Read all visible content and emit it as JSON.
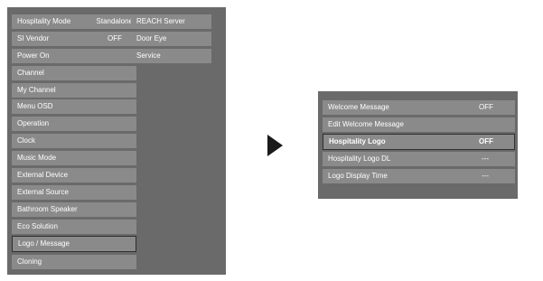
{
  "main_menu": {
    "items": [
      {
        "label": "Hospitality Mode",
        "value": "Standalone"
      },
      {
        "label": "SI Vendor",
        "value": "OFF"
      },
      {
        "label": "Power On",
        "value": ""
      },
      {
        "label": "Channel",
        "value": ""
      },
      {
        "label": "My Channel",
        "value": ""
      },
      {
        "label": "Menu OSD",
        "value": ""
      },
      {
        "label": "Operation",
        "value": ""
      },
      {
        "label": "Clock",
        "value": ""
      },
      {
        "label": "Music Mode",
        "value": ""
      },
      {
        "label": "External Device",
        "value": ""
      },
      {
        "label": "External Source",
        "value": ""
      },
      {
        "label": "Bathroom Speaker",
        "value": ""
      },
      {
        "label": "Eco Solution",
        "value": ""
      },
      {
        "label": "Logo / Message",
        "value": ""
      },
      {
        "label": "Cloning",
        "value": ""
      }
    ],
    "selected_label": "Logo / Message"
  },
  "sub_menu": {
    "items": [
      {
        "label": "REACH Server"
      },
      {
        "label": "Door Eye"
      },
      {
        "label": "Service"
      }
    ]
  },
  "logo_menu": {
    "items": [
      {
        "label": "Welcome Message",
        "value": "OFF"
      },
      {
        "label": "Edit Welcome Message",
        "value": ""
      },
      {
        "label": "Hospitality Logo",
        "value": "OFF"
      },
      {
        "label": "Hospitality Logo DL",
        "value": "---"
      },
      {
        "label": "Logo Display Time",
        "value": "---"
      }
    ],
    "selected_label": "Hospitality Logo"
  },
  "icons": {
    "arrow": "right-arrow-icon"
  }
}
